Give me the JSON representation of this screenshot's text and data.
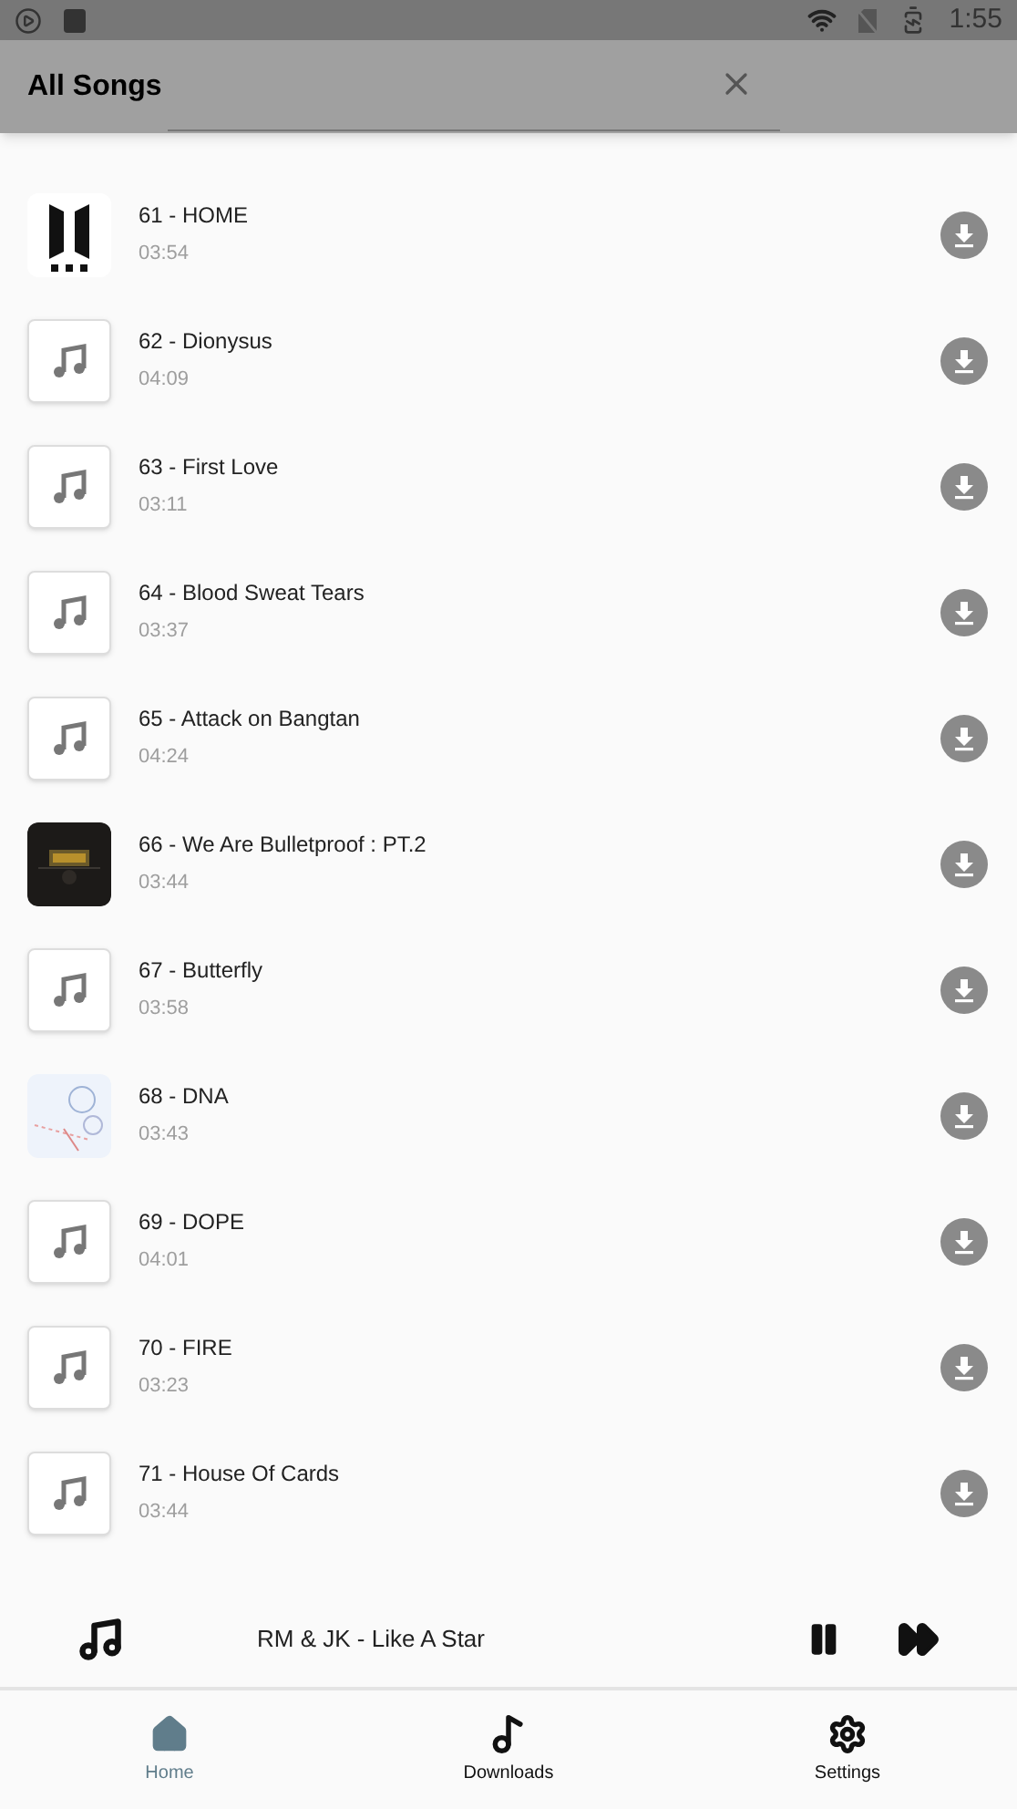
{
  "status_bar": {
    "time": "1:55"
  },
  "header": {
    "title": "All Songs"
  },
  "songs": [
    {
      "title": "61 - HOME",
      "duration": "03:54",
      "kind": "logo"
    },
    {
      "title": "62 - Dionysus",
      "duration": "04:09",
      "kind": "note"
    },
    {
      "title": "63 - First Love",
      "duration": "03:11",
      "kind": "note"
    },
    {
      "title": "64 - Blood Sweat Tears",
      "duration": "03:37",
      "kind": "note"
    },
    {
      "title": "65 - Attack on Bangtan",
      "duration": "04:24",
      "kind": "note"
    },
    {
      "title": "66 - We Are Bulletproof : PT.2",
      "duration": "03:44",
      "kind": "picture"
    },
    {
      "title": "67 - Butterfly",
      "duration": "03:58",
      "kind": "note"
    },
    {
      "title": "68 - DNA",
      "duration": "03:43",
      "kind": "sketch"
    },
    {
      "title": "69 - DOPE",
      "duration": "04:01",
      "kind": "note"
    },
    {
      "title": "70 - FIRE",
      "duration": "03:23",
      "kind": "note"
    },
    {
      "title": "71 - House Of Cards",
      "duration": "03:44",
      "kind": "note"
    }
  ],
  "player": {
    "title": "RM & JK - Like A Star",
    "playing": true
  },
  "nav": [
    {
      "label": "Home",
      "selected": true
    },
    {
      "label": "Downloads",
      "selected": false
    },
    {
      "label": "Settings",
      "selected": false
    }
  ]
}
